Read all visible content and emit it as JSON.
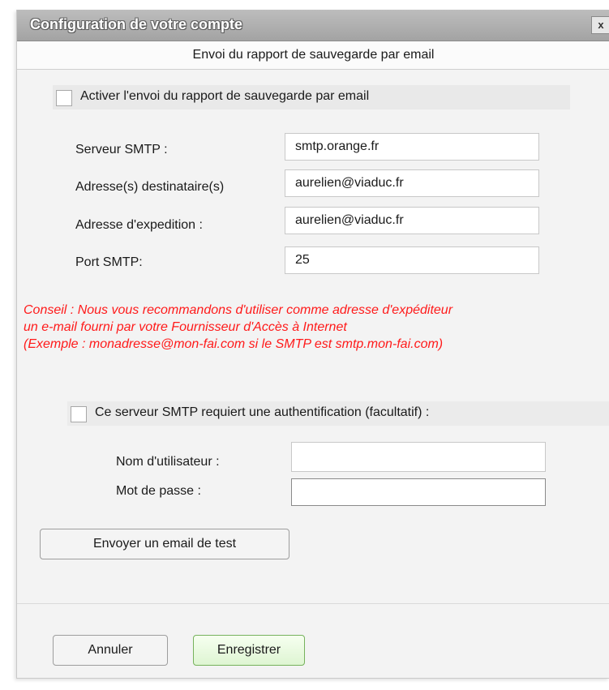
{
  "window": {
    "title": "Configuration de votre compte",
    "close_label": "x"
  },
  "section_header": "Envoi du rapport de sauvegarde par email",
  "activate_checkbox": {
    "label": "Activer l'envoi du rapport de sauvegarde par email",
    "checked": false
  },
  "fields": {
    "smtp_server": {
      "label": "Serveur SMTP :",
      "value": "smtp.orange.fr"
    },
    "recipients": {
      "label": "Adresse(s) destinataire(s)",
      "value": "aurelien@viaduc.fr"
    },
    "sender": {
      "label": "Adresse d'expedition :",
      "value": "aurelien@viaduc.fr"
    },
    "port": {
      "label": "Port SMTP:",
      "value": "25"
    }
  },
  "tip_lines": [
    "Conseil : Nous vous recommandons d'utiliser comme adresse d'expéditeur",
    "un e-mail fourni par votre Fournisseur d'Accès à Internet",
    "(Exemple : monadresse@mon-fai.com si le SMTP est smtp.mon-fai.com)"
  ],
  "auth_checkbox": {
    "label": "Ce serveur SMTP requiert une authentification (facultatif) :",
    "checked": false
  },
  "auth_fields": {
    "username": {
      "label": "Nom d'utilisateur :",
      "value": ""
    },
    "password": {
      "label": "Mot de passe :",
      "value": ""
    }
  },
  "buttons": {
    "send_test": "Envoyer un email de test",
    "cancel": "Annuler",
    "save": "Enregistrer"
  },
  "colors": {
    "tip_text": "#ff1a1a",
    "save_border": "#76b25c"
  }
}
